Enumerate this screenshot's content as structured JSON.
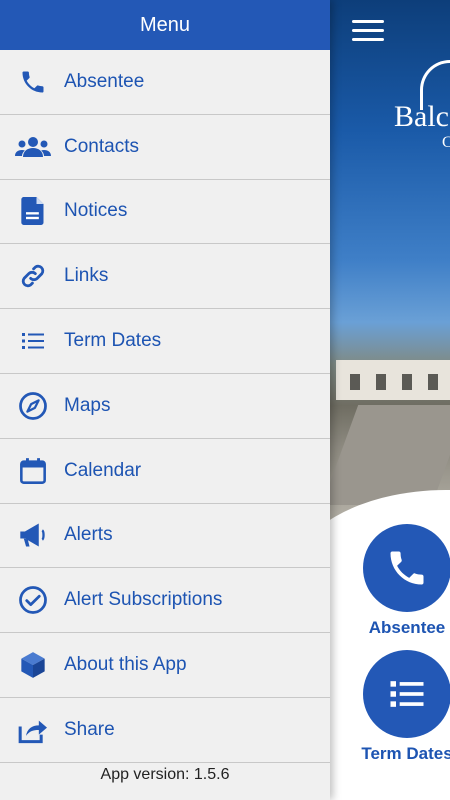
{
  "drawer": {
    "title": "Menu",
    "items": [
      {
        "label": "Absentee",
        "icon": "phone-icon"
      },
      {
        "label": "Contacts",
        "icon": "people-icon"
      },
      {
        "label": "Notices",
        "icon": "document-icon"
      },
      {
        "label": "Links",
        "icon": "link-icon"
      },
      {
        "label": "Term Dates",
        "icon": "list-icon"
      },
      {
        "label": "Maps",
        "icon": "compass-icon"
      },
      {
        "label": "Calendar",
        "icon": "calendar-icon"
      },
      {
        "label": "Alerts",
        "icon": "megaphone-icon"
      },
      {
        "label": "Alert Subscriptions",
        "icon": "check-circle-icon"
      },
      {
        "label": "About this App",
        "icon": "cube-icon"
      },
      {
        "label": "Share",
        "icon": "share-icon"
      }
    ],
    "version": "App version: 1.5.6"
  },
  "main": {
    "logo_text": "Balc",
    "logo_sub": "C",
    "tiles": [
      {
        "label": "Absentee",
        "icon": "phone-icon"
      },
      {
        "label": "Term Dates",
        "icon": "list-icon"
      }
    ]
  },
  "colors": {
    "accent": "#2358b6",
    "text_accent": "#1d54b2",
    "drawer_bg": "#f0f0f0"
  }
}
